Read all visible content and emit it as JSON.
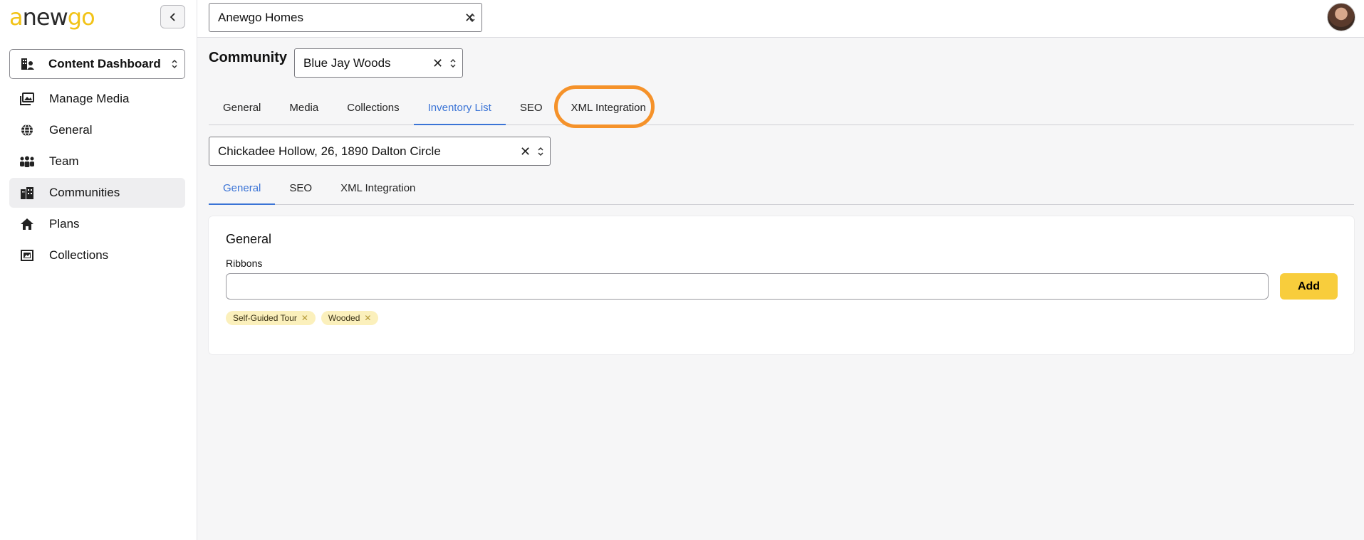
{
  "brand": {
    "logo_a": "a",
    "logo_new": "new",
    "logo_go": "go",
    "accent": "#f2c318"
  },
  "sidebar": {
    "dashboard_select": "Content Dashboard",
    "items": [
      {
        "label": "Manage Media",
        "icon": "media-icon"
      },
      {
        "label": "General",
        "icon": "globe-icon"
      },
      {
        "label": "Team",
        "icon": "team-icon"
      },
      {
        "label": "Communities",
        "icon": "buildings-icon",
        "active": true
      },
      {
        "label": "Plans",
        "icon": "home-icon"
      },
      {
        "label": "Collections",
        "icon": "collections-icon"
      }
    ]
  },
  "topbar": {
    "builder_select": "Anewgo Homes"
  },
  "community": {
    "label": "Community",
    "select": "Blue Jay Woods",
    "tabs": [
      "General",
      "Media",
      "Collections",
      "Inventory List",
      "SEO",
      "XML Integration"
    ],
    "active_tab": "Inventory List"
  },
  "inventory": {
    "select": "Chickadee Hollow, 26, 1890 Dalton Circle",
    "tabs": [
      "General",
      "SEO",
      "XML Integration"
    ],
    "active_tab": "General"
  },
  "card": {
    "title": "General",
    "ribbons_label": "Ribbons",
    "ribbons_value": "",
    "add_label": "Add",
    "chips": [
      "Self-Guided Tour",
      "Wooded"
    ]
  },
  "colors": {
    "active_tab": "#3b74d6",
    "add_button": "#f8cd3c",
    "highlight": "#f5922a",
    "chip_bg": "#fbf0bc"
  }
}
